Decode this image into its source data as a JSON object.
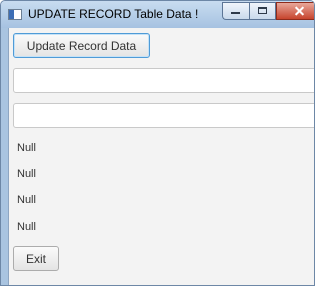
{
  "window": {
    "title": "UPDATE RECORD Table Data !",
    "icon": "app-window-icon",
    "caption_buttons": [
      "minimize-icon",
      "maximize-icon",
      "close-icon"
    ],
    "close_color": "#c7442d"
  },
  "form": {
    "update_button_label": "Update Record Data",
    "field1_value": "",
    "field2_value": "",
    "null_labels": [
      "Null",
      "Null",
      "Null",
      "Null"
    ],
    "exit_button_label": "Exit"
  }
}
